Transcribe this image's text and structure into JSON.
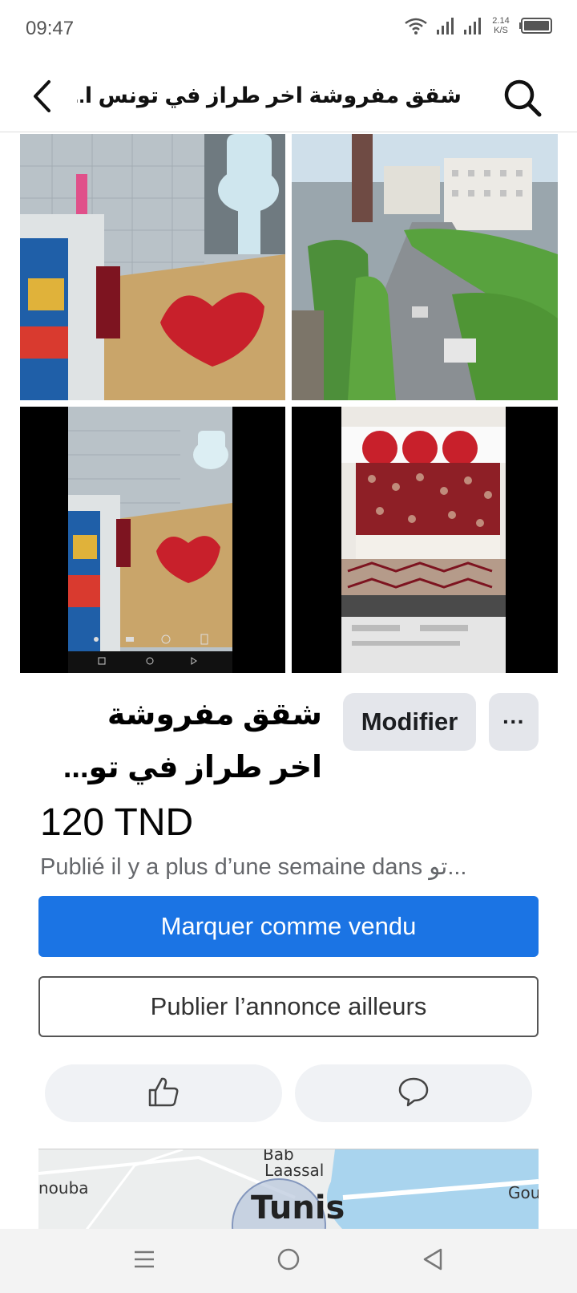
{
  "status_bar": {
    "time": "09:47",
    "net_speed_value": "2.14",
    "net_speed_unit": "K/S",
    "icons": [
      "wifi-icon",
      "signal-icon",
      "signal-icon",
      "battery-icon"
    ]
  },
  "header": {
    "title": "شقق مفروشة اخر طراز في تونس ا...",
    "back_icon": "chevron-left-icon",
    "search_icon": "search-icon"
  },
  "photos": [
    {
      "name": "bathroom-photo"
    },
    {
      "name": "tunis-avenue-photo"
    },
    {
      "name": "bathroom-screenshot-photo"
    },
    {
      "name": "bedroom-photo"
    }
  ],
  "listing": {
    "title_line1": "شقق مفروشة",
    "title_line2": "اخر طراز في تو...",
    "edit_label": "Modifier",
    "more_label": "···",
    "price": "120 TND",
    "meta": "Publié il y a plus d’une semaine dans تو..."
  },
  "actions": {
    "mark_sold_label": "Marquer comme vendu",
    "publish_elsewhere_label": "Publier l’annonce ailleurs",
    "like_icon": "thumbs-up-icon",
    "message_icon": "message-bubble-icon"
  },
  "map": {
    "label_bab": "Bab",
    "label_laassal": "Laassal",
    "label_nouba": "nouba",
    "label_tunis": "Tunis",
    "label_gou": "Gou"
  },
  "nav_bar": {
    "icons": [
      "menu-icon",
      "home-circle-icon",
      "back-triangle-icon"
    ]
  },
  "colors": {
    "primary": "#1b74e4",
    "pill_bg": "#f0f2f5",
    "secondary_text": "#65676b"
  }
}
